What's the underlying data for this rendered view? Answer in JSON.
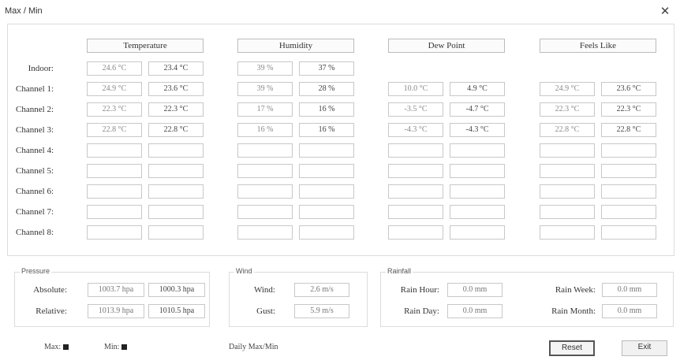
{
  "window": {
    "title": "Max / Min",
    "close_glyph": "✕"
  },
  "columns": [
    "Temperature",
    "Humidity",
    "Dew Point",
    "Feels Like"
  ],
  "rows": [
    {
      "label": "Indoor:",
      "temperature": [
        "24.6 °C",
        "23.4 °C"
      ],
      "humidity": [
        "39 %",
        "37 %"
      ],
      "dew_point": [
        "",
        ""
      ],
      "feels_like": [
        "",
        ""
      ],
      "has_dew_feels": false
    },
    {
      "label": "Channel 1:",
      "temperature": [
        "24.9 °C",
        "23.6 °C"
      ],
      "humidity": [
        "39 %",
        "28 %"
      ],
      "dew_point": [
        "10.0 °C",
        "4.9 °C"
      ],
      "feels_like": [
        "24.9 °C",
        "23.6 °C"
      ],
      "has_dew_feels": true
    },
    {
      "label": "Channel 2:",
      "temperature": [
        "22.3 °C",
        "22.3 °C"
      ],
      "humidity": [
        "17 %",
        "16 %"
      ],
      "dew_point": [
        "-3.5 °C",
        "-4.7 °C"
      ],
      "feels_like": [
        "22.3 °C",
        "22.3 °C"
      ],
      "has_dew_feels": true
    },
    {
      "label": "Channel 3:",
      "temperature": [
        "22.8 °C",
        "22.8 °C"
      ],
      "humidity": [
        "16 %",
        "16 %"
      ],
      "dew_point": [
        "-4.3 °C",
        "-4.3 °C"
      ],
      "feels_like": [
        "22.8 °C",
        "22.8 °C"
      ],
      "has_dew_feels": true
    },
    {
      "label": "Channel 4:",
      "temperature": [
        "",
        ""
      ],
      "humidity": [
        "",
        ""
      ],
      "dew_point": [
        "",
        ""
      ],
      "feels_like": [
        "",
        ""
      ],
      "has_dew_feels": true
    },
    {
      "label": "Channel 5:",
      "temperature": [
        "",
        ""
      ],
      "humidity": [
        "",
        ""
      ],
      "dew_point": [
        "",
        ""
      ],
      "feels_like": [
        "",
        ""
      ],
      "has_dew_feels": true
    },
    {
      "label": "Channel 6:",
      "temperature": [
        "",
        ""
      ],
      "humidity": [
        "",
        ""
      ],
      "dew_point": [
        "",
        ""
      ],
      "feels_like": [
        "",
        ""
      ],
      "has_dew_feels": true
    },
    {
      "label": "Channel 7:",
      "temperature": [
        "",
        ""
      ],
      "humidity": [
        "",
        ""
      ],
      "dew_point": [
        "",
        ""
      ],
      "feels_like": [
        "",
        ""
      ],
      "has_dew_feels": true
    },
    {
      "label": "Channel 8:",
      "temperature": [
        "",
        ""
      ],
      "humidity": [
        "",
        ""
      ],
      "dew_point": [
        "",
        ""
      ],
      "feels_like": [
        "",
        ""
      ],
      "has_dew_feels": true
    }
  ],
  "pressure": {
    "title": "Pressure",
    "absolute_label": "Absolute:",
    "absolute": [
      "1003.7 hpa",
      "1000.3 hpa"
    ],
    "relative_label": "Relative:",
    "relative": [
      "1013.9 hpa",
      "1010.5 hpa"
    ]
  },
  "wind": {
    "title": "Wind",
    "wind_label": "Wind:",
    "wind_value": "2.6 m/s",
    "gust_label": "Gust:",
    "gust_value": "5.9 m/s"
  },
  "rainfall": {
    "title": "Rainfall",
    "rain_hour_label": "Rain Hour:",
    "rain_hour": "0.0 mm",
    "rain_day_label": "Rain Day:",
    "rain_day": "0.0 mm",
    "rain_week_label": "Rain Week:",
    "rain_week": "0.0 mm",
    "rain_month_label": "Rain Month:",
    "rain_month": "0.0 mm"
  },
  "legend": {
    "max_label": "Max:",
    "min_label": "Min:",
    "daily_label": "Daily Max/Min"
  },
  "buttons": {
    "reset": "Reset",
    "exit": "Exit"
  },
  "colors": {
    "legend_square": "#222222"
  }
}
